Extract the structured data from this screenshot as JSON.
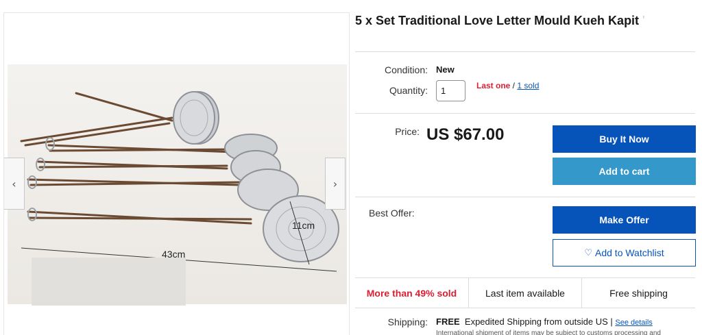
{
  "listing": {
    "title": "5 x Set Traditional Love Letter Mould Kueh Kapit",
    "title_cutoff": "'"
  },
  "gallery": {
    "photo_dimension_length": "43cm",
    "photo_dimension_diameter": "11cm",
    "prev_arrow": "‹",
    "next_arrow": "›"
  },
  "details": {
    "condition_label": "Condition:",
    "condition_value": "New",
    "quantity_label": "Quantity:",
    "quantity_value": "1",
    "last_one": "Last one",
    "separator": " / ",
    "sold_link": "1 sold"
  },
  "purchase": {
    "price_label": "Price:",
    "price_value": "US $67.00",
    "buy_now": "Buy It Now",
    "add_to_cart": "Add to cart",
    "best_offer_label": "Best Offer:",
    "make_offer": "Make Offer",
    "watchlist": "Add to Watchlist",
    "watchlist_icon": "heart-outline-icon"
  },
  "signals": {
    "sold_percent": "More than 49% sold",
    "last_item": "Last item available",
    "free_shipping": "Free shipping"
  },
  "shipping": {
    "label": "Shipping:",
    "free": "FREE",
    "method": "Expedited Shipping from outside US | ",
    "details_link": "See details",
    "note": "International shipment of items may be subject to customs processing and"
  },
  "colors": {
    "primary": "#0654ba",
    "secondary": "#3498ca",
    "alert": "#dd1e31"
  }
}
